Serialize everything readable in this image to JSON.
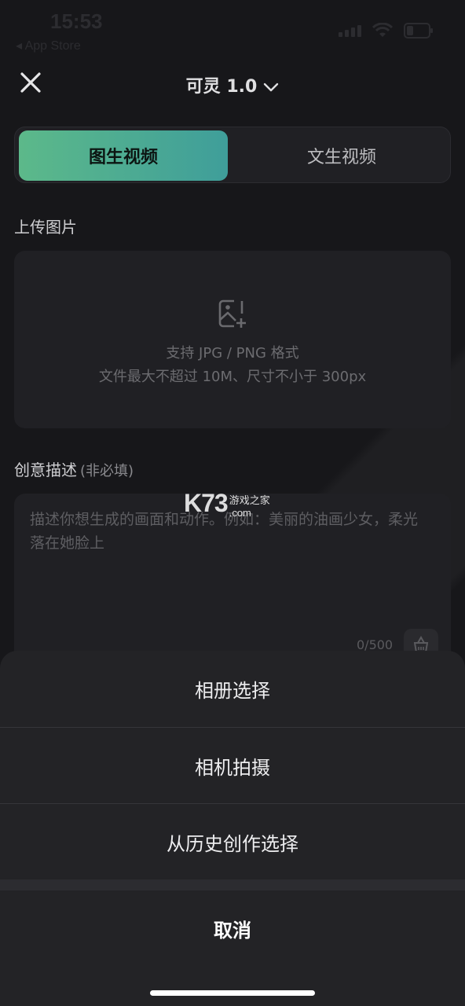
{
  "status_bar": {
    "time": "15:53",
    "back_label": "◂ App Store",
    "battery": "4"
  },
  "header": {
    "title": "可灵 1.0",
    "close_icon": "close-icon",
    "dropdown_icon": "chevron-down-icon"
  },
  "mode_tabs": [
    {
      "label": "图生视频",
      "active": true
    },
    {
      "label": "文生视频",
      "active": false
    }
  ],
  "upload": {
    "section_label": "上传图片",
    "icon": "add-image-icon",
    "line1": "支持 JPG / PNG 格式",
    "line2": "文件最大不超过 10M、尺寸不小于 300px"
  },
  "description": {
    "section_label": "创意描述",
    "optional_label": "(非必填)",
    "placeholder": "描述你想生成的画面和动作。例如：美丽的油画少女，柔光落在她脸上",
    "counter": "0/500",
    "clear_icon": "clear-icon"
  },
  "watermark": {
    "brand": "K73",
    "cn": "游戏之家",
    "domain": ".com"
  },
  "action_sheet": {
    "items": [
      "相册选择",
      "相机拍摄",
      "从历史创作选择"
    ],
    "cancel": "取消"
  },
  "colors": {
    "background": "#17171a",
    "card": "#202024",
    "accent_start": "#5cb98a",
    "accent_end": "#3f9e9a",
    "sheet": "#232326"
  }
}
